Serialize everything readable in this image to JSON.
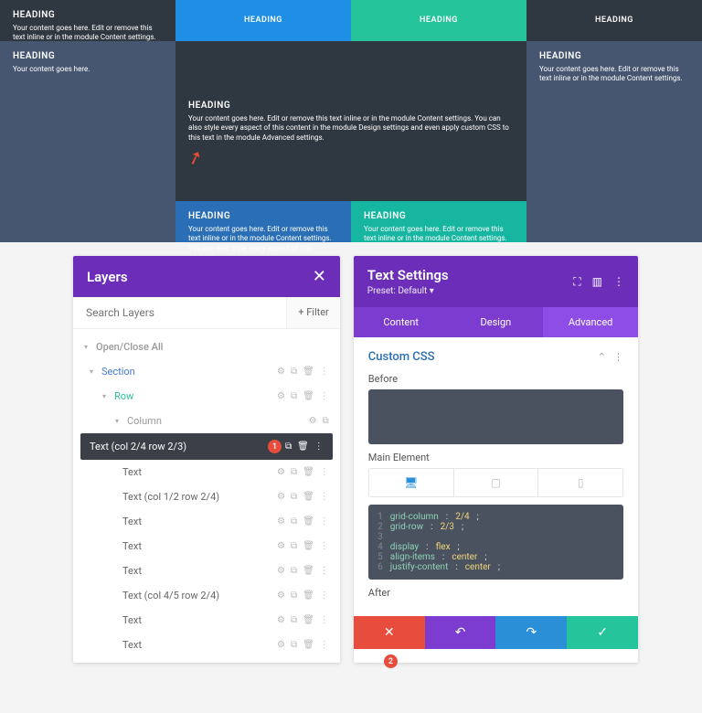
{
  "preview": {
    "heading_label": "HEADING",
    "short_text": "Your content goes here.",
    "med_text": "Your content goes here. Edit or remove this text inline or in the module Content settings.",
    "long_text": "Your content goes here. Edit or remove this text inline or in the module Content settings. You can also style every aspect of this content in the module Design settings and even apply custom CSS to this text in the module Advanced settings.",
    "med2_text": "Your content goes here. Edit or remove this text inline or in the module Content settings. You can also style every aspect of this content."
  },
  "layers": {
    "title": "Layers",
    "search_placeholder": "Search Layers",
    "filter_label": "+ Filter",
    "open_close": "Open/Close All",
    "section": "Section",
    "row": "Row",
    "column": "Column",
    "items": [
      "Text (col 2/4 row 2/3)",
      "Text",
      "Text (col 1/2 row 2/4)",
      "Text",
      "Text",
      "Text",
      "Text (col 4/5 row 2/4)",
      "Text",
      "Text"
    ],
    "badge1": "1"
  },
  "settings": {
    "title": "Text Settings",
    "preset": "Preset: Default ▾",
    "tabs": {
      "content": "Content",
      "design": "Design",
      "advanced": "Advanced"
    },
    "custom_css": "Custom CSS",
    "before": "Before",
    "main_element": "Main Element",
    "after": "After",
    "code": [
      {
        "n": "1",
        "k": "grid-column",
        "v": "2/4"
      },
      {
        "n": "2",
        "k": "grid-row",
        "v": "2/3"
      },
      {
        "n": "3",
        "k": "",
        "v": ""
      },
      {
        "n": "4",
        "k": "display",
        "v": "flex"
      },
      {
        "n": "5",
        "k": "align-items",
        "v": "center"
      },
      {
        "n": "6",
        "k": "justify-content",
        "v": "center"
      }
    ],
    "badge2": "2"
  }
}
